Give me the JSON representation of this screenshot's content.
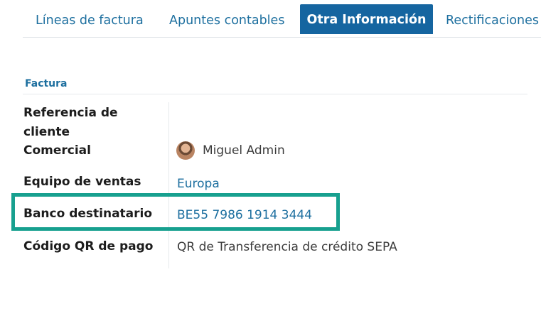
{
  "tabs": [
    {
      "label": "Líneas de factura",
      "active": false
    },
    {
      "label": "Apuntes contables",
      "active": false
    },
    {
      "label": "Otra Información",
      "active": true
    },
    {
      "label": "Rectificaciones",
      "active": false
    }
  ],
  "section": {
    "title": "Factura"
  },
  "fields": {
    "customer_reference": {
      "label": "Referencia de cliente",
      "value": ""
    },
    "salesperson": {
      "label": "Comercial",
      "value": "Miguel Admin",
      "avatar_icon": "user-avatar"
    },
    "sales_team": {
      "label": "Equipo de ventas",
      "value": "Europa"
    },
    "recipient_bank": {
      "label": "Banco destinatario",
      "value": "BE55 7986 1914 3444"
    },
    "qr_code": {
      "label": "Código QR de pago",
      "value": "QR de Transferencia de crédito SEPA"
    }
  },
  "colors": {
    "accent": "#1565a0",
    "link": "#1d6f9f",
    "highlight": "#17a08f"
  }
}
